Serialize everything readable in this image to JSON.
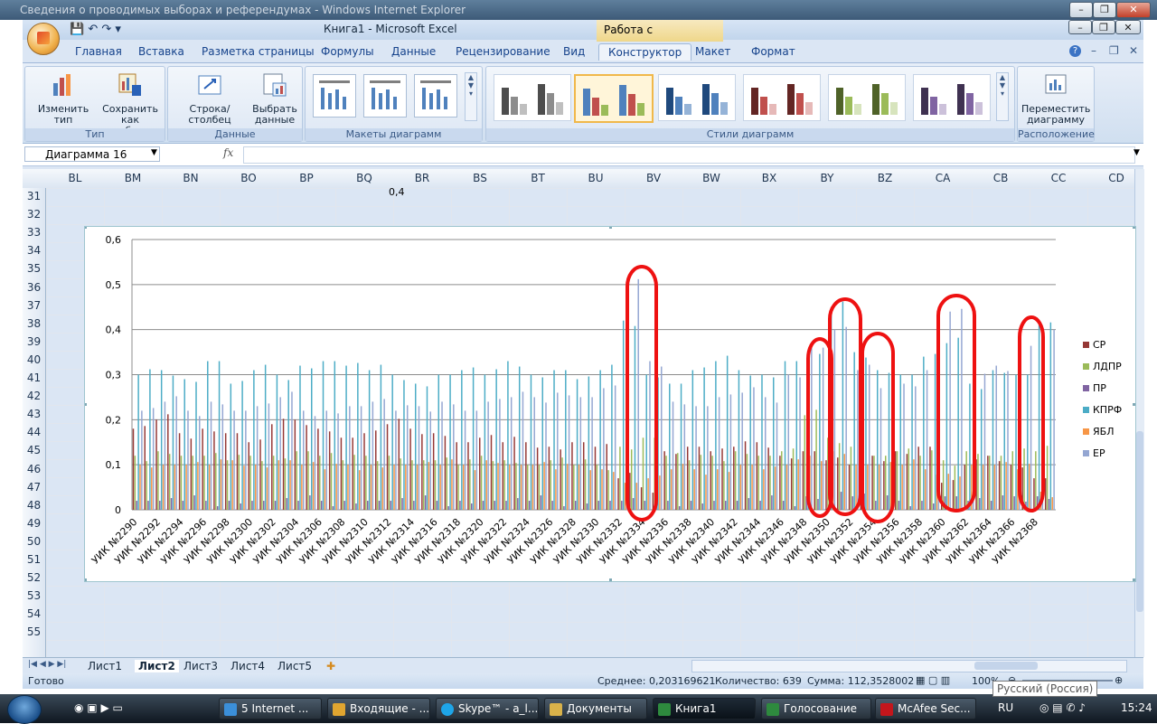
{
  "ie_window": {
    "title": "Сведения о проводимых выборах и референдумах - Windows Internet Explorer"
  },
  "excel": {
    "title": "Книга1 - Microsoft Excel",
    "context_tab": "Работа с диаграммами",
    "tabs": [
      "Главная",
      "Вставка",
      "Разметка страницы",
      "Формулы",
      "Данные",
      "Рецензирование",
      "Вид",
      "Конструктор",
      "Макет",
      "Формат"
    ],
    "active_tab": "Конструктор",
    "ribbon": {
      "change_type": "Изменить тип диаграммы",
      "save_template": "Сохранить как шаблон",
      "group_type": "Тип",
      "row_col": "Строка/столбец",
      "select_data": "Выбрать данные",
      "group_data": "Данные",
      "group_layouts": "Макеты диаграмм",
      "group_styles": "Стили диаграмм",
      "move_chart": "Переместить диаграмму",
      "group_location": "Расположение"
    },
    "name_box": "Диаграмма 16",
    "fx": "fx",
    "columns": [
      "BL",
      "BM",
      "BN",
      "BO",
      "BP",
      "BQ",
      "BR",
      "BS",
      "BT",
      "BU",
      "BV",
      "BW",
      "BX",
      "BY",
      "BZ",
      "CA",
      "CB",
      "CC",
      "CD"
    ],
    "rows": [
      "31",
      "32",
      "33",
      "34",
      "35",
      "36",
      "37",
      "38",
      "39",
      "40",
      "41",
      "42",
      "43",
      "44",
      "45",
      "46",
      "47",
      "48",
      "49",
      "50",
      "51",
      "52",
      "53",
      "54",
      "55"
    ],
    "behind_chart_label": "0,4",
    "sheets": [
      "Лист1",
      "Лист2",
      "Лист3",
      "Лист4",
      "Лист5"
    ],
    "active_sheet": "Лист2",
    "status": {
      "ready": "Готово",
      "average": "Среднее: 0,203169621",
      "count": "Количество: 639",
      "sum": "Сумма: 112,3528002",
      "zoom": "100%"
    }
  },
  "chart_data": {
    "type": "bar",
    "title": "",
    "ylim": [
      0,
      0.6
    ],
    "y_ticks": [
      "0",
      "0,1",
      "0,2",
      "0,3",
      "0,4",
      "0,5",
      "0,6"
    ],
    "grid": true,
    "legend_position": "right",
    "category_labels": [
      "УИК №2290",
      "УИК №2292",
      "УИК №2294",
      "УИК №2296",
      "УИК №2298",
      "УИК №2300",
      "УИК №2302",
      "УИК №2304",
      "УИК №2306",
      "УИК №2308",
      "УИК №2310",
      "УИК №2312",
      "УИК №2314",
      "УИК №2316",
      "УИК №2318",
      "УИК №2320",
      "УИК №2322",
      "УИК №2324",
      "УИК №2326",
      "УИК №2328",
      "УИК №2330",
      "УИК №2332",
      "УИК №2334",
      "УИК №2336",
      "УИК №2338",
      "УИК №2340",
      "УИК №2342",
      "УИК №2344",
      "УИК №2346",
      "УИК №2348",
      "УИК №2350",
      "УИК №2352",
      "УИК №2354",
      "УИК №2356",
      "УИК №2358",
      "УИК №2360",
      "УИК №2362",
      "УИК №2364",
      "УИК №2366",
      "УИК №2368"
    ],
    "series": [
      {
        "name": "СР",
        "color": "#953735",
        "values": [
          0.18,
          0.2,
          0.17,
          0.18,
          0.17,
          0.15,
          0.19,
          0.2,
          0.18,
          0.16,
          0.17,
          0.19,
          0.18,
          0.17,
          0.15,
          0.16,
          0.15,
          0.15,
          0.14,
          0.15,
          0.14,
          0.07,
          0.05,
          0.13,
          0.14,
          0.13,
          0.14,
          0.15,
          0.12,
          0.13,
          0.11,
          0.1,
          0.12,
          0.13,
          0.14,
          0.06,
          0.1,
          0.12,
          0.1,
          0.07
        ]
      },
      {
        "name": "ЛДПР",
        "color": "#9bbb59",
        "values": [
          0.12,
          0.13,
          0.12,
          0.12,
          0.11,
          0.12,
          0.12,
          0.13,
          0.12,
          0.11,
          0.12,
          0.12,
          0.11,
          0.11,
          0.1,
          0.12,
          0.11,
          0.1,
          0.11,
          0.1,
          0.1,
          0.14,
          0.16,
          0.12,
          0.11,
          0.12,
          0.13,
          0.12,
          0.13,
          0.21,
          0.16,
          0.14,
          0.12,
          0.13,
          0.12,
          0.11,
          0.13,
          0.12,
          0.13,
          0.13
        ]
      },
      {
        "name": "ПР",
        "color": "#8064a2",
        "values": [
          0.02,
          0.02,
          0.02,
          0.02,
          0.02,
          0.02,
          0.02,
          0.02,
          0.02,
          0.02,
          0.02,
          0.02,
          0.02,
          0.02,
          0.02,
          0.02,
          0.02,
          0.02,
          0.02,
          0.02,
          0.02,
          0.02,
          0.02,
          0.02,
          0.02,
          0.02,
          0.02,
          0.02,
          0.02,
          0.03,
          0.04,
          0.03,
          0.02,
          0.02,
          0.02,
          0.03,
          0.02,
          0.02,
          0.03,
          0.03
        ]
      },
      {
        "name": "КПРФ",
        "color": "#4bacc6",
        "values": [
          0.3,
          0.31,
          0.29,
          0.33,
          0.28,
          0.31,
          0.3,
          0.32,
          0.33,
          0.32,
          0.31,
          0.3,
          0.28,
          0.3,
          0.31,
          0.3,
          0.33,
          0.3,
          0.31,
          0.29,
          0.31,
          0.42,
          0.3,
          0.28,
          0.31,
          0.33,
          0.31,
          0.3,
          0.33,
          0.34,
          0.45,
          0.35,
          0.31,
          0.3,
          0.34,
          0.37,
          0.28,
          0.31,
          0.3,
          0.41
        ]
      },
      {
        "name": "ЯБЛ",
        "color": "#f79646",
        "values": [
          0.1,
          0.1,
          0.1,
          0.1,
          0.11,
          0.1,
          0.11,
          0.1,
          0.09,
          0.1,
          0.1,
          0.1,
          0.1,
          0.1,
          0.1,
          0.11,
          0.1,
          0.1,
          0.09,
          0.1,
          0.09,
          0.06,
          0.07,
          0.09,
          0.09,
          0.09,
          0.1,
          0.09,
          0.1,
          0.12,
          0.13,
          0.1,
          0.1,
          0.1,
          0.09,
          0.08,
          0.1,
          0.1,
          0.09,
          0.04
        ]
      },
      {
        "name": "ЕР",
        "color": "#94a6d2",
        "values": [
          0.22,
          0.24,
          0.22,
          0.24,
          0.22,
          0.23,
          0.25,
          0.22,
          0.22,
          0.23,
          0.24,
          0.22,
          0.23,
          0.24,
          0.22,
          0.24,
          0.25,
          0.25,
          0.26,
          0.25,
          0.27,
          0.5,
          0.33,
          0.24,
          0.23,
          0.25,
          0.26,
          0.25,
          0.3,
          0.36,
          0.4,
          0.31,
          0.27,
          0.28,
          0.31,
          0.44,
          0.29,
          0.32,
          0.37,
          0.4
        ]
      }
    ]
  },
  "taskbar": {
    "items": [
      "5 Internet ...",
      "Входящие - ...",
      "Skype™ - a_l...",
      "Документы",
      "Книга1",
      "Голосование",
      "McAfee Sec..."
    ],
    "active": "Книга1",
    "lang": "RU",
    "tooltip": "Русский (Россия)",
    "clock": "15:24"
  }
}
